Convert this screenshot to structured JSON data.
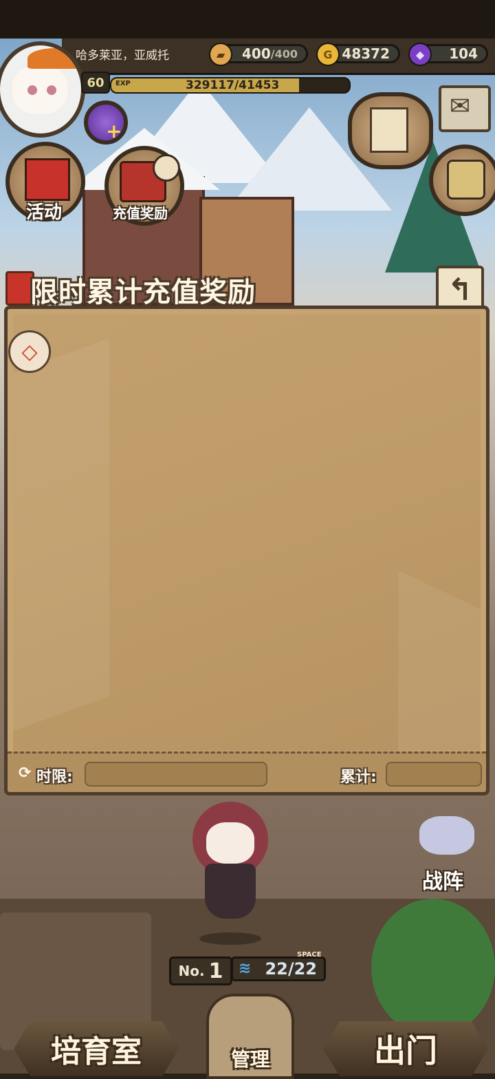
{
  "header": {
    "player_name": "哈多莱亚，亚威托",
    "level": "60",
    "exp_label": "EXP",
    "exp_value": "329117/41453",
    "exp_progress": 0.79,
    "stamina": "400",
    "stamina_max": "/400",
    "gold": "48372",
    "gems": "104"
  },
  "side_buttons": {
    "events_label": "活动",
    "recharge_reward_label": "充值奖励"
  },
  "panel": {
    "title": "限时累计充值奖励",
    "time_limit_label": "时限:",
    "cumulative_label": "累计:",
    "time_limit_value": "",
    "cumulative_value": ""
  },
  "bottom": {
    "rank_prefix": "No.",
    "rank_value": "1",
    "space_label": "SPACE",
    "space_value": "22/22",
    "formation_label": "战阵",
    "nursery_label": "培育室",
    "manage_label": "管理",
    "go_out_label": "出门"
  },
  "colors": {
    "panel_bg": "#c6a473",
    "panel_border": "#4e3d2c",
    "accent_gold": "#c8a64a",
    "gem_purple": "#7a3fc2"
  },
  "icons": [
    "bread-icon",
    "gold-coin-icon",
    "gem-icon",
    "gem-plus-icon",
    "gift-icon",
    "chest-clock-icon",
    "scroll-quest-icon",
    "mail-icon",
    "backpack-icon",
    "back-arrow-icon",
    "info-icon",
    "refresh-icon",
    "water-icon"
  ]
}
